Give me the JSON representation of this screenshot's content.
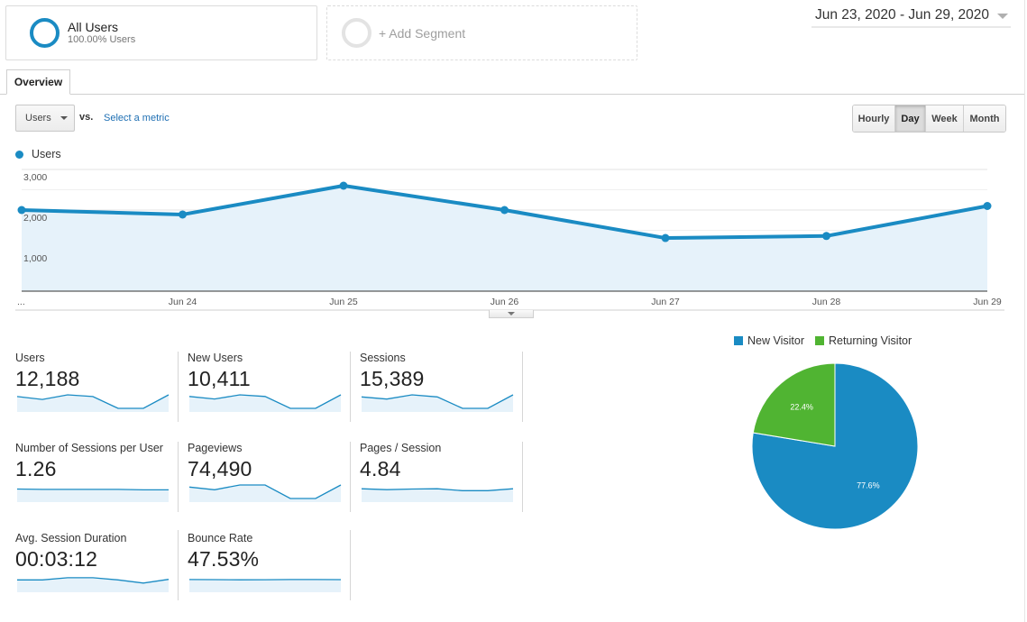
{
  "segments": {
    "all_users": {
      "title": "All Users",
      "subtitle": "100.00% Users"
    },
    "add_segment_label": "+ Add Segment"
  },
  "date_range": "Jun 23, 2020 - Jun 29, 2020",
  "tabs": [
    {
      "label": "Overview",
      "active": true
    }
  ],
  "controls": {
    "metric_select": "Users",
    "vs_label": "vs.",
    "select_metric_link": "Select a metric",
    "granularity": [
      {
        "label": "Hourly",
        "active": false
      },
      {
        "label": "Day",
        "active": true
      },
      {
        "label": "Week",
        "active": false
      },
      {
        "label": "Month",
        "active": false
      }
    ]
  },
  "colors": {
    "primary": "#1a8bc3",
    "area_fill": "#e6f2fa",
    "new_visitor": "#1a8bc3",
    "returning_visitor": "#50b432"
  },
  "chart_data": [
    {
      "type": "area",
      "title": "",
      "legend": [
        "Users"
      ],
      "legend_position": "top-left",
      "x": [
        "...",
        "Jun 24",
        "Jun 25",
        "Jun 26",
        "Jun 27",
        "Jun 28",
        "Jun 29"
      ],
      "series": [
        {
          "name": "Users",
          "values": [
            2000,
            1890,
            2600,
            2000,
            1310,
            1360,
            2100
          ]
        }
      ],
      "y_ticks": [
        "1,000",
        "2,000",
        "3,000"
      ],
      "ylim": [
        0,
        3000
      ],
      "grid": true
    },
    {
      "type": "pie",
      "legend": [
        "New Visitor",
        "Returning Visitor"
      ],
      "legend_position": "top",
      "slices": [
        {
          "name": "New Visitor",
          "value": 77.6,
          "label": "77.6%"
        },
        {
          "name": "Returning Visitor",
          "value": 22.4,
          "label": "22.4%"
        }
      ]
    }
  ],
  "metrics": [
    {
      "label": "Users",
      "value": "12,188",
      "trend": [
        2000,
        1890,
        2600,
        2000,
        1310,
        1360,
        2100
      ]
    },
    {
      "label": "New Users",
      "value": "10,411",
      "trend": [
        1700,
        1620,
        2200,
        1700,
        1100,
        1150,
        1780
      ]
    },
    {
      "label": "Sessions",
      "value": "15,389",
      "trend": [
        2500,
        2400,
        3300,
        2500,
        1650,
        1700,
        2650
      ]
    },
    {
      "label": "Number of Sessions per User",
      "value": "1.26",
      "trend": [
        1.27,
        1.26,
        1.26,
        1.26,
        1.26,
        1.25,
        1.25
      ]
    },
    {
      "label": "Pageviews",
      "value": "74,490",
      "trend": [
        12000,
        11400,
        15200,
        12500,
        8300,
        8200,
        12600
      ]
    },
    {
      "label": "Pages / Session",
      "value": "4.84",
      "trend": [
        4.9,
        4.82,
        4.88,
        4.9,
        4.72,
        4.72,
        4.9
      ]
    },
    {
      "label": "Avg. Session Duration",
      "value": "00:03:12",
      "trend": [
        190,
        190,
        198,
        198,
        190,
        178,
        192
      ]
    },
    {
      "label": "Bounce Rate",
      "value": "47.53%",
      "trend": [
        47.6,
        47.5,
        47.3,
        47.4,
        47.6,
        47.6,
        47.5
      ]
    }
  ]
}
